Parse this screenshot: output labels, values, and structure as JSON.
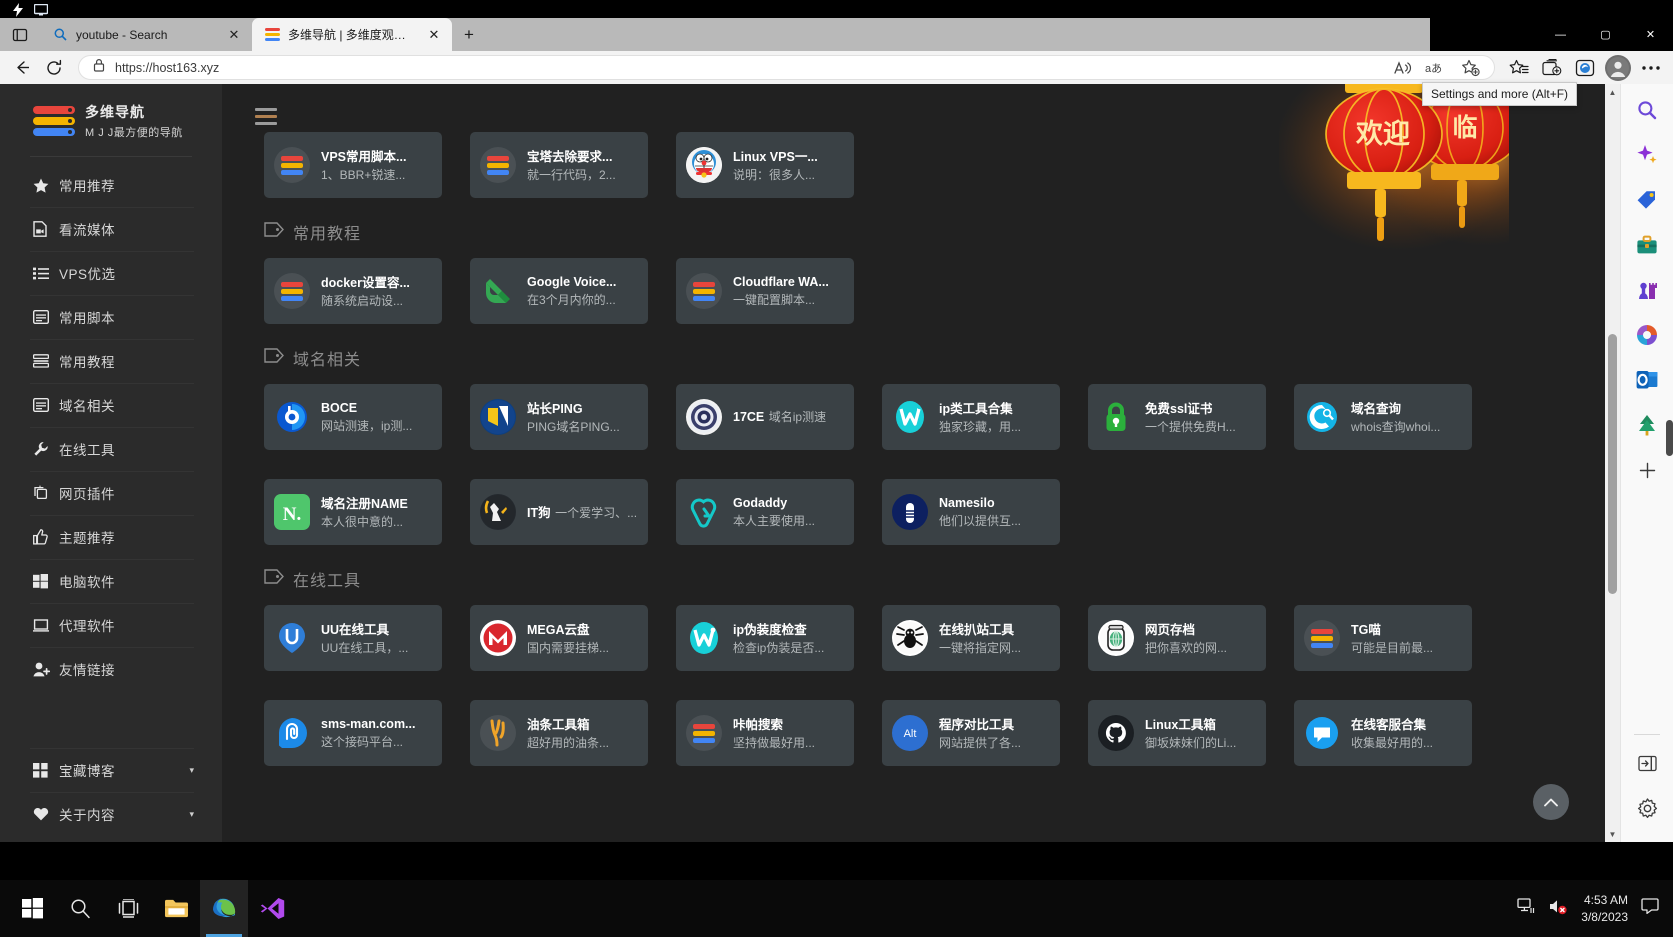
{
  "browser": {
    "tabs": [
      {
        "title": "youtube - Search",
        "favicon": "search-icon",
        "active": false
      },
      {
        "title": "多维导航 | 多维度观察网络世界",
        "favicon": "nav-bars-icon",
        "active": true
      }
    ],
    "new_tab_label": "+",
    "nav": {
      "back": "←",
      "reload": "⟳"
    },
    "omnibox": {
      "url": "https://host163.xyz",
      "lock_icon": "lock-icon"
    },
    "window_controls": {
      "minimize": "—",
      "maximize": "▢",
      "close": "✕"
    },
    "tooltip": "Settings and more (Alt+F)",
    "toolbar_icons": [
      "read-aloud-icon",
      "translate-icon",
      "add-favorite-icon",
      "favorites-icon",
      "collections-icon",
      "browser-essentials-icon",
      "profile-avatar",
      "settings-and-more-icon"
    ]
  },
  "edge_sidebar": {
    "icons": [
      "search-icon",
      "copilot-icon",
      "shopping-icon",
      "tools-icon",
      "games-icon",
      "office-icon",
      "outlook-icon",
      "tree-icon",
      "add-site-icon"
    ],
    "bottom_icons": [
      "sidebar-toggle-icon",
      "sidebar-settings-icon"
    ]
  },
  "site": {
    "brand": {
      "title": "多维导航",
      "subtitle": "M J J最方便的导航"
    },
    "menu_icon": "hamburger-icon",
    "decoration": {
      "name": "chinese-lantern",
      "text": "欢迎"
    },
    "back_to_top": "⌃",
    "sidebar": {
      "items": [
        {
          "label": "常用推荐",
          "icon": "star-icon"
        },
        {
          "label": "看流媒体",
          "icon": "media-file-icon"
        },
        {
          "label": "VPS优选",
          "icon": "list-icon"
        },
        {
          "label": "常用脚本",
          "icon": "window-icon"
        },
        {
          "label": "常用教程",
          "icon": "server-icon"
        },
        {
          "label": "域名相关",
          "icon": "window-icon"
        },
        {
          "label": "在线工具",
          "icon": "wrench-icon"
        },
        {
          "label": "网页插件",
          "icon": "plugin-icon"
        },
        {
          "label": "主题推荐",
          "icon": "thumbs-up-icon"
        },
        {
          "label": "电脑软件",
          "icon": "windows-icon"
        },
        {
          "label": "代理软件",
          "icon": "monitor-icon"
        },
        {
          "label": "友情链接",
          "icon": "user-add-icon"
        }
      ],
      "bottom_items": [
        {
          "label": "宝藏博客",
          "icon": "grid-icon",
          "caret": "▾"
        },
        {
          "label": "关于内容",
          "icon": "heart-icon",
          "caret": "▾"
        }
      ]
    },
    "sections": [
      {
        "title": "",
        "show_title": false,
        "cards": [
          {
            "title": "VPS常用脚本...",
            "desc": "1、BBR+锐速...",
            "icon": "nav-bars-icon"
          },
          {
            "title": "宝塔去除要求...",
            "desc": "就一行代码，2...",
            "icon": "nav-bars-icon"
          },
          {
            "title": "Linux VPS一...",
            "desc": "说明：很多人...",
            "icon": "doraemon-icon"
          }
        ]
      },
      {
        "title": "常用教程",
        "show_title": true,
        "cards": [
          {
            "title": "docker设置容...",
            "desc": "随系统启动设...",
            "icon": "nav-bars-icon"
          },
          {
            "title": "Google Voice...",
            "desc": "在3个月内你的...",
            "icon": "google-voice-icon"
          },
          {
            "title": "Cloudflare WA...",
            "desc": "一键配置脚本...",
            "icon": "nav-bars-icon"
          }
        ]
      },
      {
        "title": "域名相关",
        "show_title": true,
        "cards": [
          {
            "title": "BOCE",
            "desc": "网站测速，ip测...",
            "icon": "boce-icon"
          },
          {
            "title": "站长PING",
            "desc": "PING域名PING...",
            "icon": "chinaz-icon"
          },
          {
            "title": "17CE",
            "desc": "域名ip测速",
            "icon": "17ce-icon"
          },
          {
            "title": "ip类工具合集",
            "desc": "独家珍藏，用...",
            "icon": "w-teal-icon"
          },
          {
            "title": "免费ssl证书",
            "desc": "一个提供免费H...",
            "icon": "green-lock-icon"
          },
          {
            "title": "域名查询",
            "desc": "whois查询whoi...",
            "icon": "whois-icon"
          },
          {
            "title": "域名注册NAME",
            "desc": "本人很中意的...",
            "icon": "name-icon"
          },
          {
            "title": "IT狗",
            "desc": "一个爱学习、...",
            "icon": "itdog-icon"
          },
          {
            "title": "Godaddy",
            "desc": "本人主要使用...",
            "icon": "godaddy-icon"
          },
          {
            "title": "Namesilo",
            "desc": "他们以提供互...",
            "icon": "namesilo-icon"
          }
        ]
      },
      {
        "title": "在线工具",
        "show_title": true,
        "cards": [
          {
            "title": "UU在线工具",
            "desc": "UU在线工具，...",
            "icon": "uu-icon"
          },
          {
            "title": "MEGA云盘",
            "desc": "国内需要挂梯...",
            "icon": "mega-icon"
          },
          {
            "title": "ip伪装度检查",
            "desc": "检查ip伪装是否...",
            "icon": "w-teal-icon"
          },
          {
            "title": "在线扒站工具",
            "desc": "一键将指定网...",
            "icon": "spider-icon"
          },
          {
            "title": "网页存档",
            "desc": "把你喜欢的网...",
            "icon": "archive-icon"
          },
          {
            "title": "TG喵",
            "desc": "可能是目前最...",
            "icon": "nav-bars-icon"
          },
          {
            "title": "sms-man.com...",
            "desc": "这个接码平台...",
            "icon": "sms-man-icon"
          },
          {
            "title": "油条工具箱",
            "desc": "超好用的油条...",
            "icon": "youtiao-icon"
          },
          {
            "title": "咔帕搜索",
            "desc": "坚持做最好用...",
            "icon": "nav-bars-icon"
          },
          {
            "title": "程序对比工具",
            "desc": "网站提供了各...",
            "icon": "alt-icon"
          },
          {
            "title": "Linux工具箱",
            "desc": "御坂妹妹们的Li...",
            "icon": "github-icon"
          },
          {
            "title": "在线客服合集",
            "desc": "收集最好用的...",
            "icon": "chat-icon"
          }
        ]
      }
    ]
  },
  "taskbar": {
    "items": [
      "start-icon",
      "search-icon",
      "task-view-icon",
      "file-explorer-icon",
      "edge-icon",
      "vscode-icon"
    ],
    "tray": {
      "network_icon": "network-icon",
      "volume_icon": "volume-muted-icon",
      "time": "4:53 AM",
      "date": "3/8/2023",
      "notifications_icon": "notifications-icon"
    }
  },
  "colors": {
    "page_bg": "#212121",
    "sidebar_bg": "#2b2b2b",
    "card_bg": "#3a4145",
    "accent_red": "#e8453c",
    "accent_yellow": "#f4b400",
    "accent_blue": "#4285f4"
  }
}
